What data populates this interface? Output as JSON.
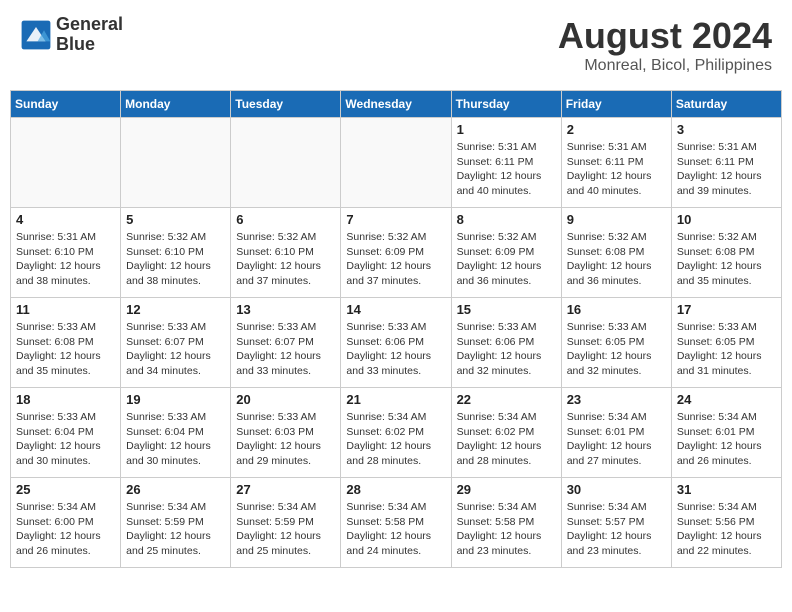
{
  "header": {
    "logo_line1": "General",
    "logo_line2": "Blue",
    "month_year": "August 2024",
    "location": "Monreal, Bicol, Philippines"
  },
  "days_of_week": [
    "Sunday",
    "Monday",
    "Tuesday",
    "Wednesday",
    "Thursday",
    "Friday",
    "Saturday"
  ],
  "weeks": [
    [
      {
        "day": "",
        "info": ""
      },
      {
        "day": "",
        "info": ""
      },
      {
        "day": "",
        "info": ""
      },
      {
        "day": "",
        "info": ""
      },
      {
        "day": "1",
        "info": "Sunrise: 5:31 AM\nSunset: 6:11 PM\nDaylight: 12 hours\nand 40 minutes."
      },
      {
        "day": "2",
        "info": "Sunrise: 5:31 AM\nSunset: 6:11 PM\nDaylight: 12 hours\nand 40 minutes."
      },
      {
        "day": "3",
        "info": "Sunrise: 5:31 AM\nSunset: 6:11 PM\nDaylight: 12 hours\nand 39 minutes."
      }
    ],
    [
      {
        "day": "4",
        "info": "Sunrise: 5:31 AM\nSunset: 6:10 PM\nDaylight: 12 hours\nand 38 minutes."
      },
      {
        "day": "5",
        "info": "Sunrise: 5:32 AM\nSunset: 6:10 PM\nDaylight: 12 hours\nand 38 minutes."
      },
      {
        "day": "6",
        "info": "Sunrise: 5:32 AM\nSunset: 6:10 PM\nDaylight: 12 hours\nand 37 minutes."
      },
      {
        "day": "7",
        "info": "Sunrise: 5:32 AM\nSunset: 6:09 PM\nDaylight: 12 hours\nand 37 minutes."
      },
      {
        "day": "8",
        "info": "Sunrise: 5:32 AM\nSunset: 6:09 PM\nDaylight: 12 hours\nand 36 minutes."
      },
      {
        "day": "9",
        "info": "Sunrise: 5:32 AM\nSunset: 6:08 PM\nDaylight: 12 hours\nand 36 minutes."
      },
      {
        "day": "10",
        "info": "Sunrise: 5:32 AM\nSunset: 6:08 PM\nDaylight: 12 hours\nand 35 minutes."
      }
    ],
    [
      {
        "day": "11",
        "info": "Sunrise: 5:33 AM\nSunset: 6:08 PM\nDaylight: 12 hours\nand 35 minutes."
      },
      {
        "day": "12",
        "info": "Sunrise: 5:33 AM\nSunset: 6:07 PM\nDaylight: 12 hours\nand 34 minutes."
      },
      {
        "day": "13",
        "info": "Sunrise: 5:33 AM\nSunset: 6:07 PM\nDaylight: 12 hours\nand 33 minutes."
      },
      {
        "day": "14",
        "info": "Sunrise: 5:33 AM\nSunset: 6:06 PM\nDaylight: 12 hours\nand 33 minutes."
      },
      {
        "day": "15",
        "info": "Sunrise: 5:33 AM\nSunset: 6:06 PM\nDaylight: 12 hours\nand 32 minutes."
      },
      {
        "day": "16",
        "info": "Sunrise: 5:33 AM\nSunset: 6:05 PM\nDaylight: 12 hours\nand 32 minutes."
      },
      {
        "day": "17",
        "info": "Sunrise: 5:33 AM\nSunset: 6:05 PM\nDaylight: 12 hours\nand 31 minutes."
      }
    ],
    [
      {
        "day": "18",
        "info": "Sunrise: 5:33 AM\nSunset: 6:04 PM\nDaylight: 12 hours\nand 30 minutes."
      },
      {
        "day": "19",
        "info": "Sunrise: 5:33 AM\nSunset: 6:04 PM\nDaylight: 12 hours\nand 30 minutes."
      },
      {
        "day": "20",
        "info": "Sunrise: 5:33 AM\nSunset: 6:03 PM\nDaylight: 12 hours\nand 29 minutes."
      },
      {
        "day": "21",
        "info": "Sunrise: 5:34 AM\nSunset: 6:02 PM\nDaylight: 12 hours\nand 28 minutes."
      },
      {
        "day": "22",
        "info": "Sunrise: 5:34 AM\nSunset: 6:02 PM\nDaylight: 12 hours\nand 28 minutes."
      },
      {
        "day": "23",
        "info": "Sunrise: 5:34 AM\nSunset: 6:01 PM\nDaylight: 12 hours\nand 27 minutes."
      },
      {
        "day": "24",
        "info": "Sunrise: 5:34 AM\nSunset: 6:01 PM\nDaylight: 12 hours\nand 26 minutes."
      }
    ],
    [
      {
        "day": "25",
        "info": "Sunrise: 5:34 AM\nSunset: 6:00 PM\nDaylight: 12 hours\nand 26 minutes."
      },
      {
        "day": "26",
        "info": "Sunrise: 5:34 AM\nSunset: 5:59 PM\nDaylight: 12 hours\nand 25 minutes."
      },
      {
        "day": "27",
        "info": "Sunrise: 5:34 AM\nSunset: 5:59 PM\nDaylight: 12 hours\nand 25 minutes."
      },
      {
        "day": "28",
        "info": "Sunrise: 5:34 AM\nSunset: 5:58 PM\nDaylight: 12 hours\nand 24 minutes."
      },
      {
        "day": "29",
        "info": "Sunrise: 5:34 AM\nSunset: 5:58 PM\nDaylight: 12 hours\nand 23 minutes."
      },
      {
        "day": "30",
        "info": "Sunrise: 5:34 AM\nSunset: 5:57 PM\nDaylight: 12 hours\nand 23 minutes."
      },
      {
        "day": "31",
        "info": "Sunrise: 5:34 AM\nSunset: 5:56 PM\nDaylight: 12 hours\nand 22 minutes."
      }
    ]
  ]
}
